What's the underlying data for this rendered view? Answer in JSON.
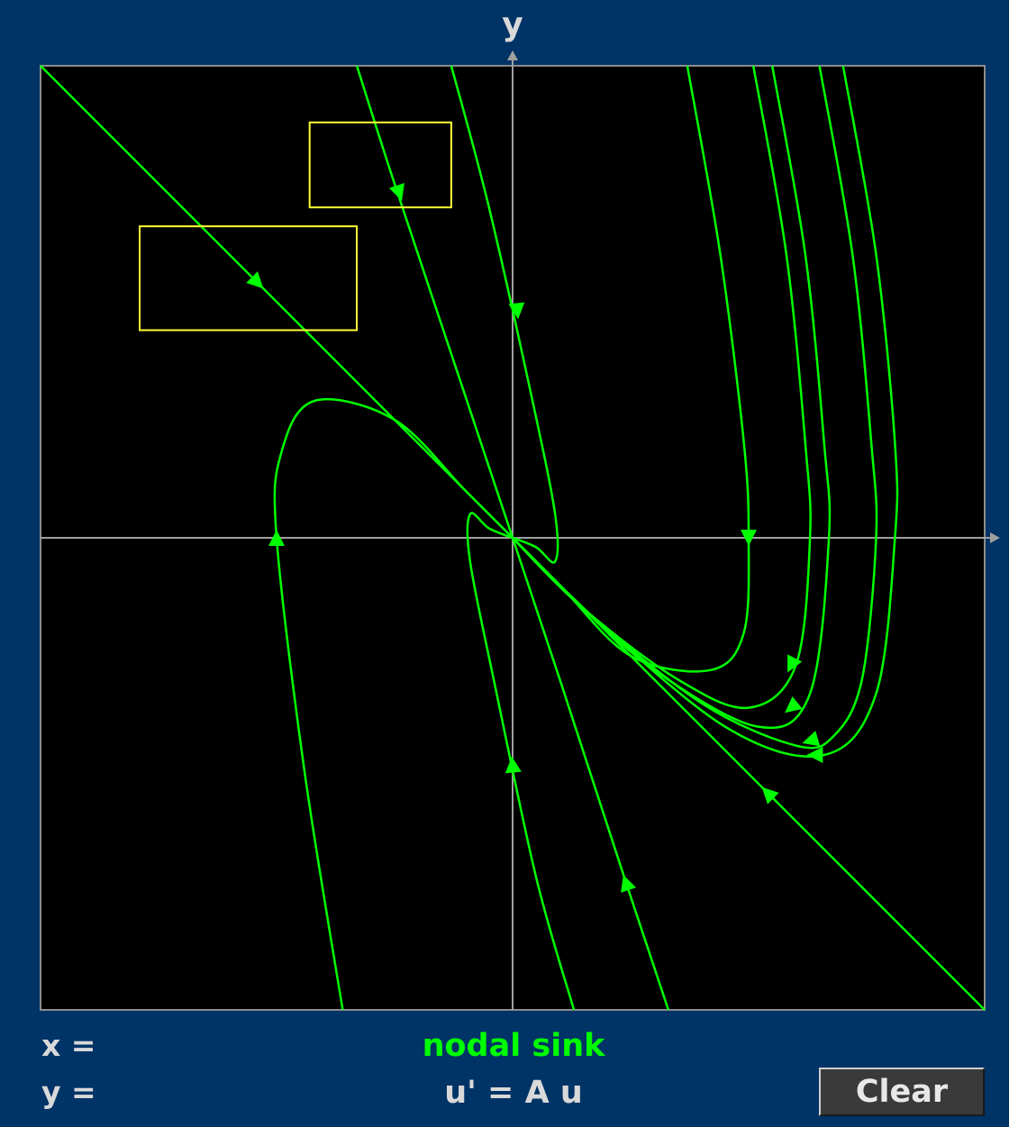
{
  "axes": {
    "y_label": "y",
    "x_label": ""
  },
  "readouts": {
    "x_label": "x =",
    "y_label": "y ="
  },
  "status": {
    "classification": "nodal sink",
    "equation": "u' = A u"
  },
  "buttons": {
    "clear_label": "Clear"
  },
  "colors": {
    "background": "#003366",
    "plot_background": "#000000",
    "trajectory": "#00ff00",
    "axis": "#a0a0a0",
    "selection_box": "#ffff33",
    "frame": "#8c8c8c"
  },
  "chart_data": {
    "type": "phase-portrait",
    "xlim": [
      -1,
      1
    ],
    "ylim": [
      -1,
      1
    ],
    "grid": false,
    "classification": "nodal sink",
    "eigen_directions": [
      {
        "dx": 1,
        "dy": -1
      },
      {
        "dx": 1,
        "dy": -3
      }
    ],
    "trajectories": [
      {
        "points": [
          [
            -1.0,
            1.0
          ],
          [
            -0.85,
            0.85
          ],
          [
            -0.5,
            0.5
          ],
          [
            -0.2,
            0.2
          ],
          [
            0.0,
            0.0
          ],
          [
            0.3,
            -0.3
          ],
          [
            0.6,
            -0.6
          ],
          [
            1.0,
            -1.0
          ]
        ]
      },
      {
        "points": [
          [
            -0.33,
            1.0
          ],
          [
            -0.25,
            0.75
          ],
          [
            -0.1,
            0.3
          ],
          [
            0.0,
            0.0
          ],
          [
            0.1,
            -0.3
          ],
          [
            0.24,
            -0.73
          ],
          [
            0.33,
            -1.0
          ]
        ]
      },
      {
        "points": [
          [
            -0.13,
            1.0
          ],
          [
            -0.05,
            0.7
          ],
          [
            0.04,
            0.3
          ],
          [
            0.09,
            0.05
          ],
          [
            0.09,
            -0.05
          ],
          [
            0.05,
            -0.02
          ],
          [
            0.0,
            0.0
          ]
        ]
      },
      {
        "points": [
          [
            0.13,
            -1.0
          ],
          [
            0.05,
            -0.72
          ],
          [
            -0.04,
            -0.3
          ],
          [
            -0.09,
            -0.05
          ],
          [
            -0.09,
            0.05
          ],
          [
            -0.05,
            0.02
          ],
          [
            0.0,
            0.0
          ]
        ]
      },
      {
        "points": [
          [
            -0.36,
            -1.0
          ],
          [
            -0.44,
            -0.5
          ],
          [
            -0.5,
            0.0
          ],
          [
            -0.49,
            0.18
          ],
          [
            -0.42,
            0.29
          ],
          [
            -0.25,
            0.25
          ],
          [
            -0.1,
            0.1
          ],
          [
            0.0,
            0.0
          ]
        ]
      },
      {
        "points": [
          [
            0.37,
            1.0
          ],
          [
            0.44,
            0.6
          ],
          [
            0.49,
            0.2
          ],
          [
            0.5,
            0.0
          ],
          [
            0.49,
            -0.2
          ],
          [
            0.42,
            -0.28
          ],
          [
            0.25,
            -0.25
          ],
          [
            0.1,
            -0.1
          ],
          [
            0.0,
            0.0
          ]
        ]
      },
      {
        "points": [
          [
            0.51,
            1.0
          ],
          [
            0.58,
            0.6
          ],
          [
            0.62,
            0.2
          ],
          [
            0.63,
            0.0
          ],
          [
            0.6,
            -0.27
          ],
          [
            0.5,
            -0.36
          ],
          [
            0.35,
            -0.3
          ],
          [
            0.15,
            -0.15
          ],
          [
            0.0,
            0.0
          ]
        ]
      },
      {
        "points": [
          [
            0.55,
            1.0
          ],
          [
            0.62,
            0.6
          ],
          [
            0.66,
            0.2
          ],
          [
            0.67,
            0.0
          ],
          [
            0.63,
            -0.33
          ],
          [
            0.52,
            -0.4
          ],
          [
            0.3,
            -0.28
          ],
          [
            0.12,
            -0.12
          ],
          [
            0.0,
            0.0
          ]
        ]
      },
      {
        "points": [
          [
            0.65,
            1.0
          ],
          [
            0.72,
            0.6
          ],
          [
            0.76,
            0.2
          ],
          [
            0.77,
            0.0
          ],
          [
            0.74,
            -0.3
          ],
          [
            0.68,
            -0.42
          ],
          [
            0.6,
            -0.44
          ],
          [
            0.4,
            -0.35
          ],
          [
            0.15,
            -0.15
          ],
          [
            0.0,
            0.0
          ]
        ]
      },
      {
        "points": [
          [
            0.7,
            1.0
          ],
          [
            0.77,
            0.6
          ],
          [
            0.81,
            0.2
          ],
          [
            0.81,
            0.0
          ],
          [
            0.77,
            -0.33
          ],
          [
            0.66,
            -0.46
          ],
          [
            0.45,
            -0.4
          ],
          [
            0.15,
            -0.15
          ],
          [
            0.0,
            0.0
          ]
        ]
      }
    ],
    "arrows": [
      {
        "x": -0.54,
        "y": 0.54,
        "dx": 1,
        "dy": -1
      },
      {
        "x": -0.24,
        "y": 0.73,
        "dx": 1,
        "dy": -3
      },
      {
        "x": 0.01,
        "y": 0.48,
        "dx": 0.1,
        "dy": -1
      },
      {
        "x": -0.5,
        "y": 0.0,
        "dx": 0,
        "dy": 1
      },
      {
        "x": 0.5,
        "y": 0.0,
        "dx": 0,
        "dy": -1
      },
      {
        "x": -0.0,
        "y": -0.48,
        "dx": -0.1,
        "dy": 1
      },
      {
        "x": 0.24,
        "y": -0.73,
        "dx": -1,
        "dy": 3
      },
      {
        "x": 0.54,
        "y": -0.54,
        "dx": -1,
        "dy": 1
      },
      {
        "x": 0.59,
        "y": -0.27,
        "dx": -0.5,
        "dy": -1
      },
      {
        "x": 0.59,
        "y": -0.36,
        "dx": -1,
        "dy": -0.8
      },
      {
        "x": 0.63,
        "y": -0.43,
        "dx": -1,
        "dy": -0.3
      },
      {
        "x": 0.64,
        "y": -0.46,
        "dx": -1,
        "dy": 0
      }
    ],
    "selection_boxes": [
      {
        "x0": -0.43,
        "x1": -0.13,
        "y0": 0.7,
        "y1": 0.88
      },
      {
        "x0": -0.79,
        "x1": -0.33,
        "y0": 0.44,
        "y1": 0.66
      }
    ]
  }
}
